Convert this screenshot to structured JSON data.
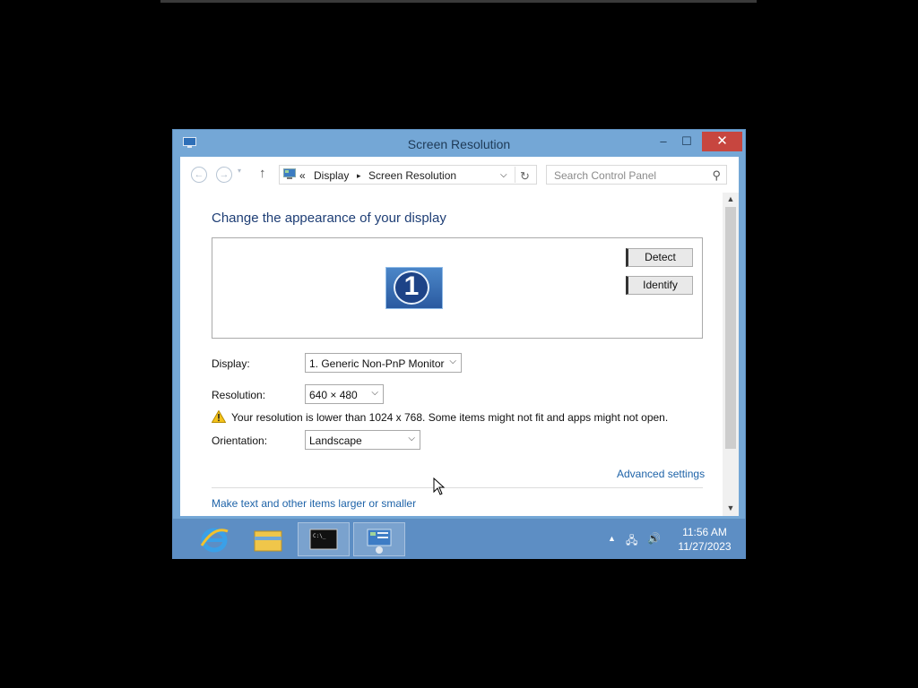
{
  "window": {
    "title": "Screen Resolution",
    "controls": {
      "minimize": "–",
      "maximize": "☐",
      "close": "✕"
    }
  },
  "nav": {
    "back_icon": "back-arrow-icon",
    "forward_icon": "forward-arrow-icon",
    "breadcrumb": {
      "prefix": "«",
      "items": [
        "Display",
        "Screen Resolution"
      ],
      "separator": "▸"
    },
    "search_placeholder": "Search Control Panel"
  },
  "main": {
    "heading": "Change the appearance of your display",
    "monitor_number": "1",
    "detect_label": "Detect",
    "identify_label": "Identify",
    "display_label": "Display:",
    "display_value": "1. Generic Non-PnP Monitor",
    "resolution_label": "Resolution:",
    "resolution_value": "640 × 480",
    "warning_text": "Your resolution is lower than 1024 x 768. Some items might not fit and apps might not open.",
    "orientation_label": "Orientation:",
    "orientation_value": "Landscape",
    "advanced_link": "Advanced settings",
    "text_size_link": "Make text and other items larger or smaller"
  },
  "taskbar": {
    "items": [
      "internet-explorer-icon",
      "file-explorer-icon",
      "command-prompt-icon",
      "control-panel-icon"
    ],
    "clock_time": "11:56 AM",
    "clock_date": "11/27/2023"
  },
  "colors": {
    "window_frame": "#74a7d6",
    "taskbar": "#5d8ec4",
    "close_button": "#c7463f",
    "link": "#1e63a8",
    "heading": "#1e3e75"
  }
}
